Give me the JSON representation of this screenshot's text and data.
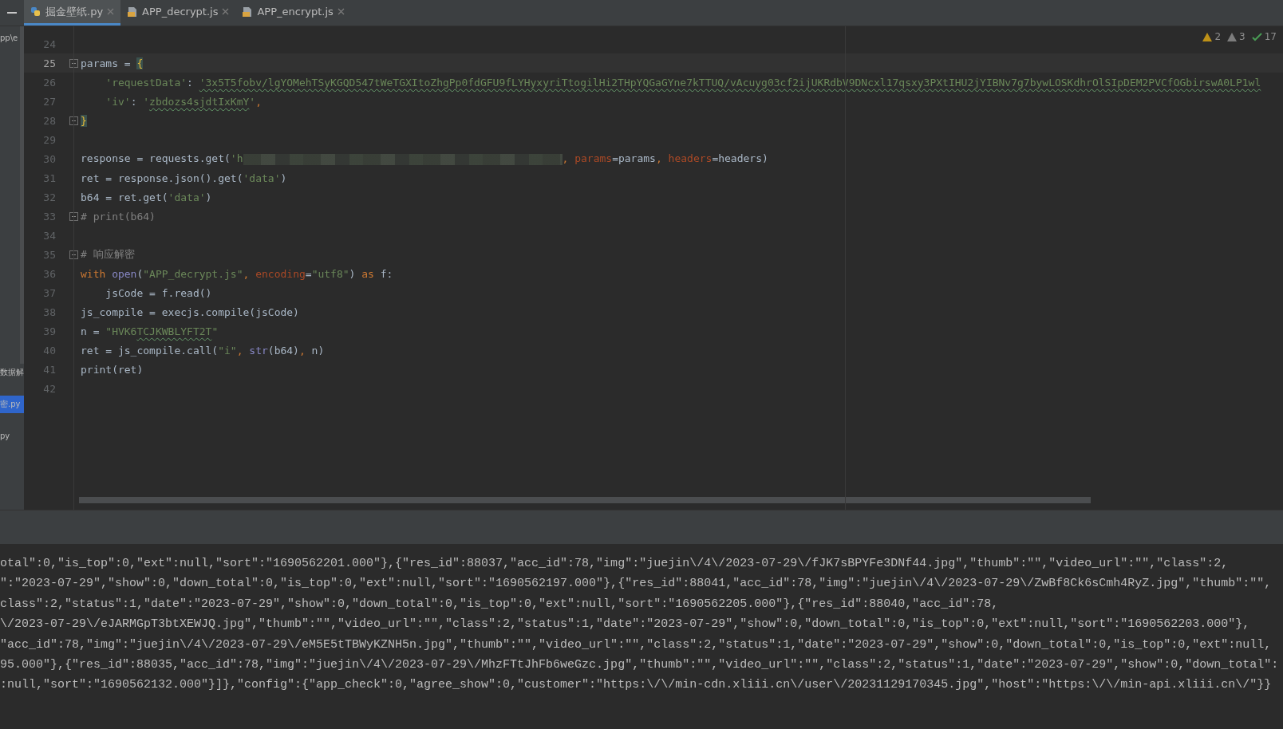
{
  "tabs": [
    {
      "label": "掘金壁纸.py",
      "kind": "python",
      "selected": true
    },
    {
      "label": "APP_decrypt.js",
      "kind": "js",
      "selected": false
    },
    {
      "label": "APP_encrypt.js",
      "kind": "js",
      "selected": false
    }
  ],
  "sidebar": {
    "items": [
      {
        "text": "pp\\e",
        "selected": false
      },
      {
        "text": "数据解",
        "selected": false
      },
      {
        "text": "密.py",
        "selected": true
      },
      {
        "text": "py",
        "selected": false
      }
    ]
  },
  "inspections": [
    {
      "kind": "warning",
      "count": "2"
    },
    {
      "kind": "weak_warning",
      "count": "3"
    },
    {
      "kind": "typo",
      "count": "17"
    }
  ],
  "code_lines": [
    {
      "number": "24",
      "current": false,
      "fold": false
    },
    {
      "number": "25",
      "current": true,
      "fold": true,
      "tokens": [
        {
          "kind": "plain",
          "text": "params = "
        },
        {
          "kind": "brace",
          "text": "{"
        }
      ]
    },
    {
      "number": "26",
      "current": false,
      "fold": false,
      "tokens": [
        {
          "kind": "string",
          "text": "    'requestData'"
        },
        {
          "kind": "plain",
          "text": ": "
        },
        {
          "kind": "string",
          "typo": true,
          "text": "'3x5T5fobv/lgYOMehTSyKGQD547tWeTGXItoZhgPp0fdGFU9fLYHyxyriTtogilHi2THpYQGaGYne7kTTUQ/vAcuyg03cf2ijUKRdbV9DNcxl17qsxy3PXtIHU2jYIBNv7g7bywLOSKdhrOlSIpDEM2PVCfOGbirswA0LP1wl"
        }
      ]
    },
    {
      "number": "27",
      "current": false,
      "fold": false,
      "tokens": [
        {
          "kind": "string",
          "text": "    'iv'"
        },
        {
          "kind": "plain",
          "text": ": "
        },
        {
          "kind": "string",
          "text": "'"
        },
        {
          "kind": "string",
          "typo": true,
          "text": "zbdozs4sjdtIxKmY"
        },
        {
          "kind": "string",
          "text": "'"
        },
        {
          "kind": "keyword",
          "text": ","
        }
      ]
    },
    {
      "number": "28",
      "current": false,
      "fold": true,
      "tokens": [
        {
          "kind": "brace",
          "text": "}"
        }
      ]
    },
    {
      "number": "29",
      "current": false,
      "fold": false
    },
    {
      "number": "30",
      "current": false,
      "fold": false,
      "tokens": [
        {
          "kind": "plain",
          "text": "response = requests.get("
        },
        {
          "kind": "string",
          "text": "'h"
        },
        {
          "kind": "redacted"
        },
        {
          "kind": "keyword",
          "text": ", "
        },
        {
          "kind": "param",
          "text": "params"
        },
        {
          "kind": "plain",
          "text": "=params"
        },
        {
          "kind": "keyword",
          "text": ", "
        },
        {
          "kind": "param",
          "text": "headers"
        },
        {
          "kind": "plain",
          "text": "=headers)"
        }
      ]
    },
    {
      "number": "31",
      "current": false,
      "fold": false,
      "tokens": [
        {
          "kind": "plain",
          "text": "ret = response.json().get("
        },
        {
          "kind": "string",
          "text": "'data'"
        },
        {
          "kind": "plain",
          "text": ")"
        }
      ]
    },
    {
      "number": "32",
      "current": false,
      "fold": false,
      "tokens": [
        {
          "kind": "plain",
          "text": "b64 = ret.get("
        },
        {
          "kind": "string",
          "text": "'data'"
        },
        {
          "kind": "plain",
          "text": ")"
        }
      ]
    },
    {
      "number": "33",
      "current": false,
      "fold": true,
      "tokens": [
        {
          "kind": "comment",
          "text": "# print(b64)"
        }
      ]
    },
    {
      "number": "34",
      "current": false,
      "fold": false
    },
    {
      "number": "35",
      "current": false,
      "fold": true,
      "tokens": [
        {
          "kind": "comment",
          "text": "# 响应解密"
        }
      ]
    },
    {
      "number": "36",
      "current": false,
      "fold": false,
      "tokens": [
        {
          "kind": "keyword",
          "text": "with "
        },
        {
          "kind": "builtin",
          "text": "open"
        },
        {
          "kind": "plain",
          "text": "("
        },
        {
          "kind": "string",
          "text": "\"APP_decrypt.js\""
        },
        {
          "kind": "keyword",
          "text": ", "
        },
        {
          "kind": "param",
          "text": "encoding"
        },
        {
          "kind": "plain",
          "text": "="
        },
        {
          "kind": "string",
          "text": "\"utf8\""
        },
        {
          "kind": "plain",
          "text": ") "
        },
        {
          "kind": "keyword",
          "text": "as "
        },
        {
          "kind": "plain",
          "text": "f:"
        }
      ]
    },
    {
      "number": "37",
      "current": false,
      "fold": false,
      "tokens": [
        {
          "kind": "plain",
          "text": "    jsCode = f.read()"
        }
      ]
    },
    {
      "number": "38",
      "current": false,
      "fold": false,
      "tokens": [
        {
          "kind": "plain",
          "text": "js_compile = execjs.compile(jsCode)"
        }
      ]
    },
    {
      "number": "39",
      "current": false,
      "fold": false,
      "tokens": [
        {
          "kind": "plain",
          "text": "n = "
        },
        {
          "kind": "string",
          "text": "\"HVK6"
        },
        {
          "kind": "string",
          "typo": true,
          "text": "TCJKWBLYFT2T"
        },
        {
          "kind": "string",
          "text": "\""
        }
      ]
    },
    {
      "number": "40",
      "current": false,
      "fold": false,
      "tokens": [
        {
          "kind": "plain",
          "text": "ret = js_compile.call("
        },
        {
          "kind": "string",
          "text": "\"i\""
        },
        {
          "kind": "keyword",
          "text": ", "
        },
        {
          "kind": "builtin",
          "text": "str"
        },
        {
          "kind": "plain",
          "text": "(b64)"
        },
        {
          "kind": "keyword",
          "text": ", "
        },
        {
          "kind": "plain",
          "text": "n)"
        }
      ]
    },
    {
      "number": "41",
      "current": false,
      "fold": false,
      "tokens": [
        {
          "kind": "plain",
          "text": "print(ret)"
        }
      ]
    },
    {
      "number": "42",
      "current": false,
      "fold": false
    }
  ],
  "output_lines": [
    "otal\":0,\"is_top\":0,\"ext\":null,\"sort\":\"1690562201.000\"},{\"res_id\":88037,\"acc_id\":78,\"img\":\"juejin\\/4\\/2023-07-29\\/fJK7sBPYFe3DNf44.jpg\",\"thumb\":\"\",\"video_url\":\"\",\"class\":2,",
    "\":\"2023-07-29\",\"show\":0,\"down_total\":0,\"is_top\":0,\"ext\":null,\"sort\":\"1690562197.000\"},{\"res_id\":88041,\"acc_id\":78,\"img\":\"juejin\\/4\\/2023-07-29\\/ZwBf8Ck6sCmh4RyZ.jpg\",\"thumb\":\"\",",
    "class\":2,\"status\":1,\"date\":\"2023-07-29\",\"show\":0,\"down_total\":0,\"is_top\":0,\"ext\":null,\"sort\":\"1690562205.000\"},{\"res_id\":88040,\"acc_id\":78,",
    "\\/2023-07-29\\/eJARMGpT3btXEWJQ.jpg\",\"thumb\":\"\",\"video_url\":\"\",\"class\":2,\"status\":1,\"date\":\"2023-07-29\",\"show\":0,\"down_total\":0,\"is_top\":0,\"ext\":null,\"sort\":\"1690562203.000\"},",
    "\"acc_id\":78,\"img\":\"juejin\\/4\\/2023-07-29\\/eM5E5tTBWyKZNH5n.jpg\",\"thumb\":\"\",\"video_url\":\"\",\"class\":2,\"status\":1,\"date\":\"2023-07-29\",\"show\":0,\"down_total\":0,\"is_top\":0,\"ext\":null,",
    "95.000\"},{\"res_id\":88035,\"acc_id\":78,\"img\":\"juejin\\/4\\/2023-07-29\\/MhzFTtJhFb6weGzc.jpg\",\"thumb\":\"\",\"video_url\":\"\",\"class\":2,\"status\":1,\"date\":\"2023-07-29\",\"show\":0,\"down_total\":",
    ":null,\"sort\":\"1690562132.000\"}]},\"config\":{\"app_check\":0,\"agree_show\":0,\"customer\":\"https:\\/\\/min-cdn.xliii.cn\\/user\\/20231129170345.jpg\",\"host\":\"https:\\/\\/min-api.xliii.cn\\/\"}}"
  ]
}
